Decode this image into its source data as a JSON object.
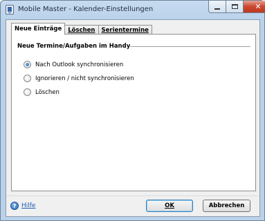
{
  "window": {
    "title": "Mobile Master - Kalender-Einstellungen"
  },
  "tabs": [
    {
      "label": "Neue Einträge",
      "active": true
    },
    {
      "label": "Löschen",
      "active": false
    },
    {
      "label": "Serientermine",
      "active": false
    }
  ],
  "panel": {
    "group_title": "Neue Termine/Aufgaben im Handy",
    "options": [
      {
        "label": "Nach Outlook synchronisieren",
        "checked": true
      },
      {
        "label": "Ignorieren / nicht synchronisieren",
        "checked": false
      },
      {
        "label": "Löschen",
        "checked": false
      }
    ]
  },
  "footer": {
    "help_label": "Hilfe",
    "ok_label": "OK",
    "cancel_label": "Abbrechen"
  },
  "colors": {
    "frame": "#b9d1ea",
    "close_button": "#c9472f",
    "link": "#1a5fb4"
  },
  "icons": [
    "app-icon",
    "minimize-icon",
    "maximize-icon",
    "close-icon",
    "help-icon"
  ]
}
